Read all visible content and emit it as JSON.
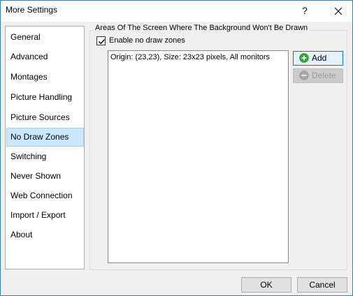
{
  "window": {
    "title": "More Settings",
    "help_glyph": "?",
    "close_icon": "close-icon"
  },
  "sidebar": {
    "items": [
      {
        "label": "General",
        "selected": false
      },
      {
        "label": "Advanced",
        "selected": false
      },
      {
        "label": "Montages",
        "selected": false
      },
      {
        "label": "Picture Handling",
        "selected": false
      },
      {
        "label": "Picture Sources",
        "selected": false
      },
      {
        "label": "No Draw Zones",
        "selected": true
      },
      {
        "label": "Switching",
        "selected": false
      },
      {
        "label": "Never Shown",
        "selected": false
      },
      {
        "label": "Web Connection",
        "selected": false
      },
      {
        "label": "Import / Export",
        "selected": false
      },
      {
        "label": "About",
        "selected": false
      }
    ]
  },
  "panel": {
    "group_title": "Areas Of The Screen Where The Background Won't Be Drawn",
    "enable_checkbox": {
      "label": "Enable no draw zones",
      "checked": true
    },
    "zones": [
      "Origin: (23,23), Size: 23x23 pixels, All monitors"
    ],
    "add_button": {
      "label": "Add",
      "icon": "plus-circle-icon",
      "enabled": true
    },
    "delete_button": {
      "label": "Delete",
      "icon": "minus-circle-icon",
      "enabled": false
    }
  },
  "footer": {
    "ok_label": "OK",
    "cancel_label": "Cancel"
  },
  "colors": {
    "selection_bg": "#cce8ff",
    "add_icon": "#3aa53a",
    "accent_border": "#0078d7"
  }
}
